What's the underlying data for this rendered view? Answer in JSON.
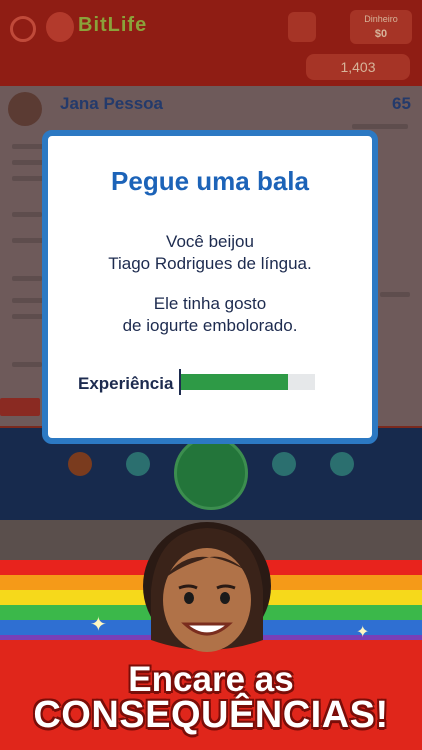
{
  "app": {
    "logo_text": "BitLife",
    "money_label": "Dinheiro",
    "money_value": "$0",
    "ribbons_value": "1,403"
  },
  "profile": {
    "name": "Jana Pessoa",
    "age": "65"
  },
  "modal": {
    "title": "Pegue uma bala",
    "line1": "Você beijou",
    "line2": "Tiago Rodrigues de língua.",
    "line3": "Ele tinha gosto",
    "line4": "de iogurte embolorado.",
    "experience_label": "Experiência",
    "experience_fraction": 0.8
  },
  "caption": {
    "line1": "Encare as",
    "line2": "CONSEQUÊNCIAS!"
  },
  "colors": {
    "modal_border": "#2c79c3",
    "title_blue": "#1c63b8",
    "experience_green": "#2e9a46",
    "caption_red": "#e0261b"
  }
}
